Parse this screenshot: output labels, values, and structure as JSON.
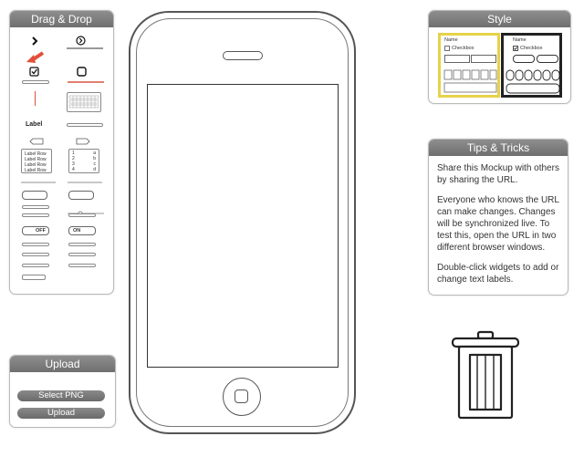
{
  "panels": {
    "drag_drop": {
      "title": "Drag & Drop"
    },
    "style": {
      "title": "Style",
      "sample": {
        "name_label": "Name",
        "checkbox_label": "Checkbox"
      }
    },
    "tips": {
      "title": "Tips & Tricks",
      "paragraphs": [
        "Share this Mockup with others by sharing the URL.",
        "Everyone who knows the URL can make changes. Changes will be synchronized live. To test this, open the URL in two different browser windows.",
        "Double-click widgets to add or change text labels."
      ]
    },
    "upload": {
      "title": "Upload",
      "select_button": "Select PNG",
      "upload_button": "Upload"
    }
  },
  "widgets": {
    "label_text": "Label",
    "toggle_off": "OFF",
    "toggle_on": "ON",
    "list_rows": [
      "Label Row",
      "Label Row",
      "Label Row",
      "Label Row"
    ],
    "table_col_a": [
      "1",
      "2",
      "3",
      "4"
    ],
    "table_col_b": [
      "a",
      "b",
      "c",
      "d"
    ]
  },
  "colors": {
    "header_bg": "#7b7b7b",
    "arrow_accent": "#e0503a",
    "style_selected_border": "#e6d24a",
    "style_option_border": "#222222"
  },
  "icons": [
    "chevron-right-icon",
    "circle-chevron-icon",
    "red-arrow-icon",
    "checkbox-checked-icon",
    "checkbox-empty-icon",
    "trash-icon",
    "home-button-icon"
  ]
}
